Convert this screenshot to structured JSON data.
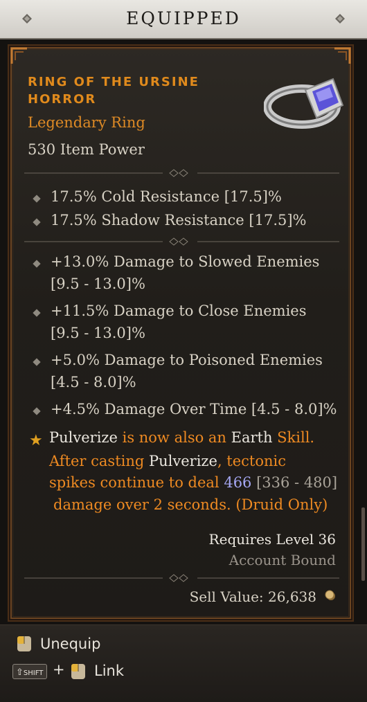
{
  "header": {
    "title": "EQUIPPED"
  },
  "item": {
    "name": "RING OF THE URSINE HORROR",
    "type": "Legendary Ring",
    "power": "530 Item Power",
    "implicits": [
      "17.5% Cold Resistance [17.5]%",
      "17.5% Shadow Resistance [17.5]%"
    ],
    "affixes": [
      {
        "line1": "+13.0% Damage to Slowed Enemies",
        "line2": "[9.5 - 13.0]%"
      },
      {
        "line1": "+11.5% Damage to Close Enemies",
        "line2": "[9.5 - 13.0]%"
      },
      {
        "line1": "+5.0% Damage to Poisoned Enemies",
        "line2": "[4.5 - 8.0]%"
      },
      {
        "line1": "+4.5% Damage Over Time [4.5 - 8.0]%",
        "line2": ""
      }
    ],
    "legendary_power": {
      "l1a": "Pulverize",
      "l1b": " is now also an ",
      "l1c": "Earth",
      "l1d": " Skill.",
      "l2a": "After casting ",
      "l2b": "Pulverize",
      "l2c": ", tectonic",
      "l3a": "spikes continue to deal ",
      "l3b": "466",
      "l3c": " [336 - 480]",
      "l4": "damage over 2 seconds. (Druid Only)"
    },
    "requires": "Requires Level 36",
    "bound": "Account Bound",
    "sell_label": "Sell Value: ",
    "sell_value": "26,638"
  },
  "footer": {
    "unequip_label": "Unequip",
    "shift_label": "SHIFT",
    "plus": "+",
    "link_label": "Link"
  },
  "colors": {
    "legendary_orange": "#ee8a22",
    "value_blue": "#a6a8f4",
    "header_bg": "#e9e7e2"
  },
  "icons": [
    "ring-item-icon",
    "gold-coin-icon",
    "mouse-left-icon",
    "shift-key-icon"
  ]
}
